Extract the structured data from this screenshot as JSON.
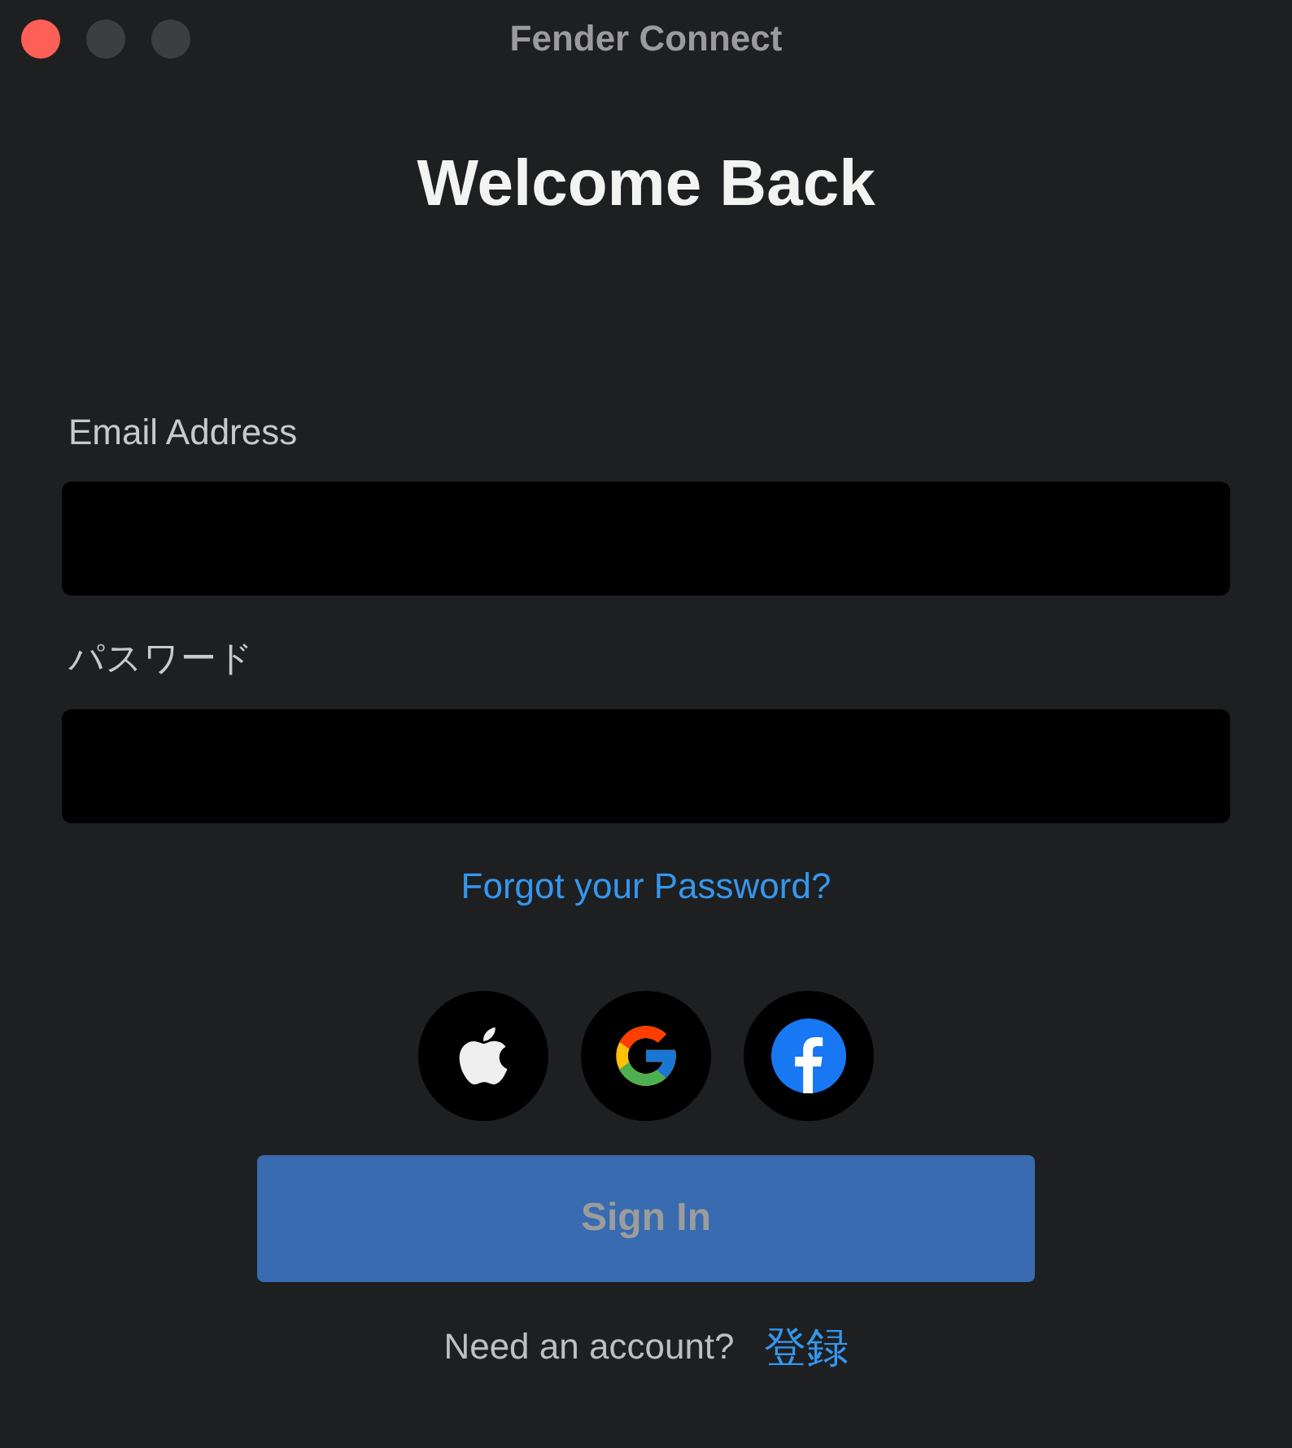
{
  "window": {
    "title": "Fender Connect",
    "traffic_lights": [
      {
        "kind": "close",
        "enabled": true
      },
      {
        "kind": "minimize",
        "enabled": false
      },
      {
        "kind": "zoom",
        "enabled": false
      }
    ]
  },
  "heading": "Welcome Back",
  "fields": [
    {
      "label": "Email Address"
    },
    {
      "label": "パスワード"
    }
  ],
  "forgot_link": "Forgot your Password?",
  "social_buttons": [
    {
      "kind": "apple"
    },
    {
      "kind": "google"
    },
    {
      "kind": "facebook"
    }
  ],
  "sign_in_button": {
    "label": "Sign In",
    "disabled": true
  },
  "footer": {
    "text": "Need an account?",
    "link": "登録"
  }
}
